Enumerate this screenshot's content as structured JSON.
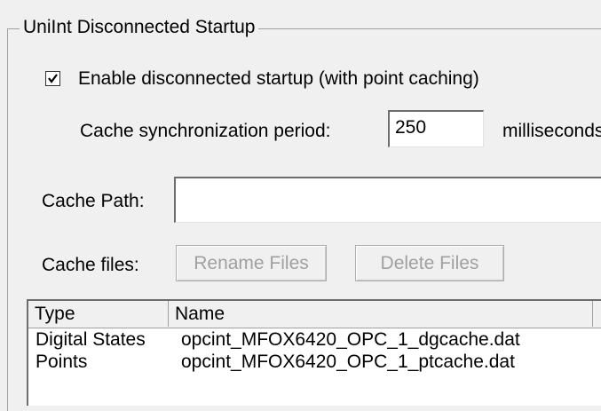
{
  "group": {
    "title": "UniInt Disconnected Startup"
  },
  "enable": {
    "checked": true,
    "label": "Enable disconnected startup (with point caching)"
  },
  "sync": {
    "label": "Cache synchronization period:",
    "value": "250",
    "unit": "milliseconds"
  },
  "cache_path": {
    "label": "Cache Path:",
    "value": ""
  },
  "cache_files": {
    "label": "Cache files:",
    "rename_label": "Rename Files",
    "delete_label": "Delete Files"
  },
  "table": {
    "columns": [
      "Type",
      "Name"
    ],
    "rows": [
      {
        "type": "Digital States",
        "name": "opcint_MFOX6420_OPC_1_dgcache.dat"
      },
      {
        "type": "Points",
        "name": "opcint_MFOX6420_OPC_1_ptcache.dat"
      }
    ]
  }
}
